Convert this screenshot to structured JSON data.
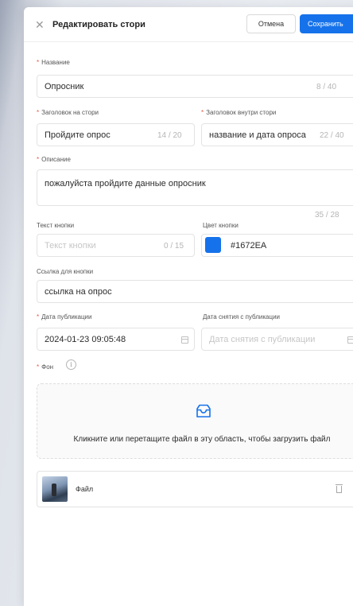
{
  "header": {
    "title": "Редактировать стори",
    "cancel_label": "Отмена",
    "save_label": "Сохранить"
  },
  "form": {
    "name": {
      "label": "Название",
      "required": true,
      "value": "Опросник",
      "counter": "8 / 40"
    },
    "story_heading": {
      "label": "Заголовок на стори",
      "required": true,
      "value": "Пройдите опрос",
      "counter": "14 / 20"
    },
    "inner_heading": {
      "label": "Заголовок внутри стори",
      "required": true,
      "value": "название и дата опроса",
      "counter": "22 / 40"
    },
    "description": {
      "label": "Описание",
      "required": true,
      "value": "пожалуйста пройдите данные опросник",
      "counter": "35 / 28"
    },
    "button_text": {
      "label": "Текст кнопки",
      "placeholder": "Текст кнопки",
      "counter": "0 / 15"
    },
    "button_color": {
      "label": "Цвет кнопки",
      "value": "#1672EA",
      "swatch_color": "#1672EA"
    },
    "button_link": {
      "label": "Ссылка для кнопки",
      "value": "ссылка на опрос"
    },
    "publish_date": {
      "label": "Дата публикации",
      "required": true,
      "value": "2024-01-23 09:05:48"
    },
    "unpublish_date": {
      "label": "Дата снятия с публикации",
      "placeholder": "Дата снятия с публикации"
    },
    "background": {
      "label": "Фон",
      "required": true
    }
  },
  "upload": {
    "text": "Кликните или перетащите файл в эту область, чтобы загрузить файл",
    "icon": "inbox-icon"
  },
  "file": {
    "name": "Файл",
    "icon": "trash-icon"
  },
  "colors": {
    "accent": "#1672EA",
    "required_mark": "#E8594A"
  }
}
